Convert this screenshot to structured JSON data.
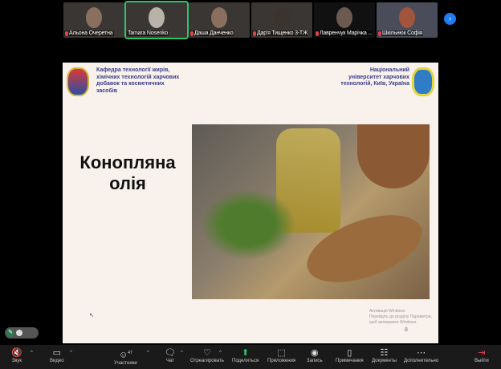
{
  "participants": [
    {
      "name": "Альона Очеретна"
    },
    {
      "name": "Tamara Nosenko",
      "active": true
    },
    {
      "name": "Даша Данченко"
    },
    {
      "name": "Дар'я Тищенко 3-ТЖ"
    },
    {
      "name": "Лавренчук Марічка ..."
    },
    {
      "name": "Шкільнюк Софія"
    }
  ],
  "slide": {
    "department": "Кафедра технології жирів, хімічних технологій харчових добавок та косметичних засобів",
    "university": "Національний університет харчових технологій, Київ, Україна",
    "title_line1": "Конопляна",
    "title_line2": "олія",
    "activation_line1": "Активація Windows",
    "activation_line2": "Перейдіть до розділу Параметри, щоб активувати Windows.",
    "page_number": "8"
  },
  "toolbar": {
    "audio": "Звук",
    "video": "Видео",
    "participants": "Участники",
    "participants_count": "47",
    "chat": "Чат",
    "react": "Отреагировать",
    "share": "Поделиться",
    "apps": "Приложения",
    "record": "Запись",
    "notes": "Примечания",
    "docs": "Документы",
    "more": "Дополнительно",
    "leave": "Выйти"
  },
  "colors": {
    "accent": "#1f7cf0",
    "share": "#2fc46b",
    "leave": "#e0434b"
  }
}
